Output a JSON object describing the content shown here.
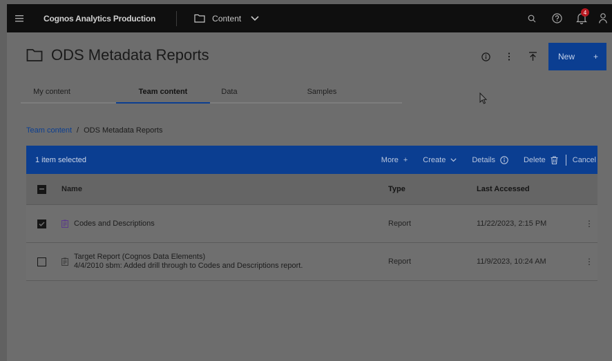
{
  "topbar": {
    "app_title": "Cognos Analytics Production",
    "content_label": "Content",
    "notification_count": "4"
  },
  "page": {
    "title": "ODS Metadata Reports",
    "new_button": "New",
    "new_plus": "+"
  },
  "tabs": [
    {
      "label": "My content"
    },
    {
      "label": "Team content"
    },
    {
      "label": "Data"
    },
    {
      "label": "Samples"
    }
  ],
  "breadcrumb": {
    "root": "Team content",
    "separator": "/",
    "current": "ODS Metadata Reports"
  },
  "selection_bar": {
    "count_label": "1 item selected",
    "more": "More",
    "more_sym": "+",
    "create": "Create",
    "details": "Details",
    "delete": "Delete",
    "cancel": "Cancel"
  },
  "table": {
    "columns": {
      "name": "Name",
      "type": "Type",
      "last_accessed": "Last Accessed"
    },
    "rows": [
      {
        "name": "Codes and Descriptions",
        "description": "",
        "type": "Report",
        "last_accessed": "11/22/2023, 2:15 PM",
        "checked": true
      },
      {
        "name": "Target Report (Cognos Data Elements)",
        "description": "4/4/2010 sbm: Added drill through to Codes and Descriptions report.",
        "type": "Report",
        "last_accessed": "11/9/2023, 10:24 AM",
        "checked": false
      }
    ]
  },
  "colors": {
    "accent": "#0b3e91",
    "topbar": "#0f0f0f",
    "overlay": "#6d6d6d",
    "badge": "#b81921"
  }
}
